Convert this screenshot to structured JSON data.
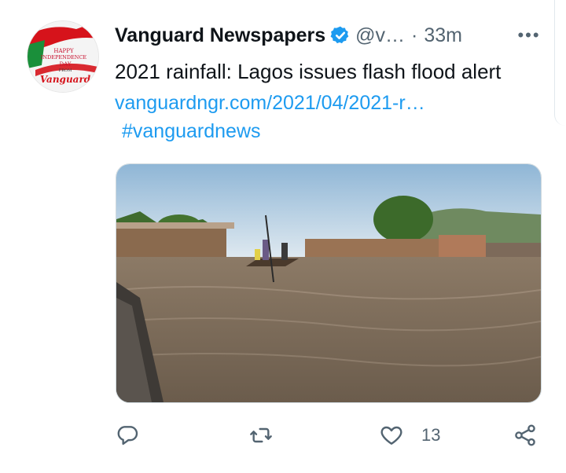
{
  "tweet": {
    "display_name": "Vanguard Newspapers",
    "handle": "@v…",
    "separator": "·",
    "timestamp": "33m",
    "more_label": "•••",
    "text": "2021 rainfall: Lagos issues flash flood alert",
    "link": "vanguardngr.com/2021/04/2021-r…",
    "hashtag": "#vanguardnews",
    "avatar": {
      "line1": "HAPPY",
      "line2": "INDEPENDENCE",
      "line3": "DAY",
      "line4": "FROM",
      "brand": "Vanguard"
    },
    "icons": {
      "verified": "verified-badge-icon",
      "more": "more-options-icon",
      "reply": "reply-icon",
      "retweet": "retweet-icon",
      "like": "heart-icon",
      "share": "share-icon"
    }
  },
  "actions": {
    "reply_count": "",
    "retweet_count": "",
    "like_count": "13"
  },
  "colors": {
    "link": "#1d9bf0",
    "verified": "#1d9bf0",
    "secondary_text": "#536471",
    "brand_red": "#d6131b"
  }
}
